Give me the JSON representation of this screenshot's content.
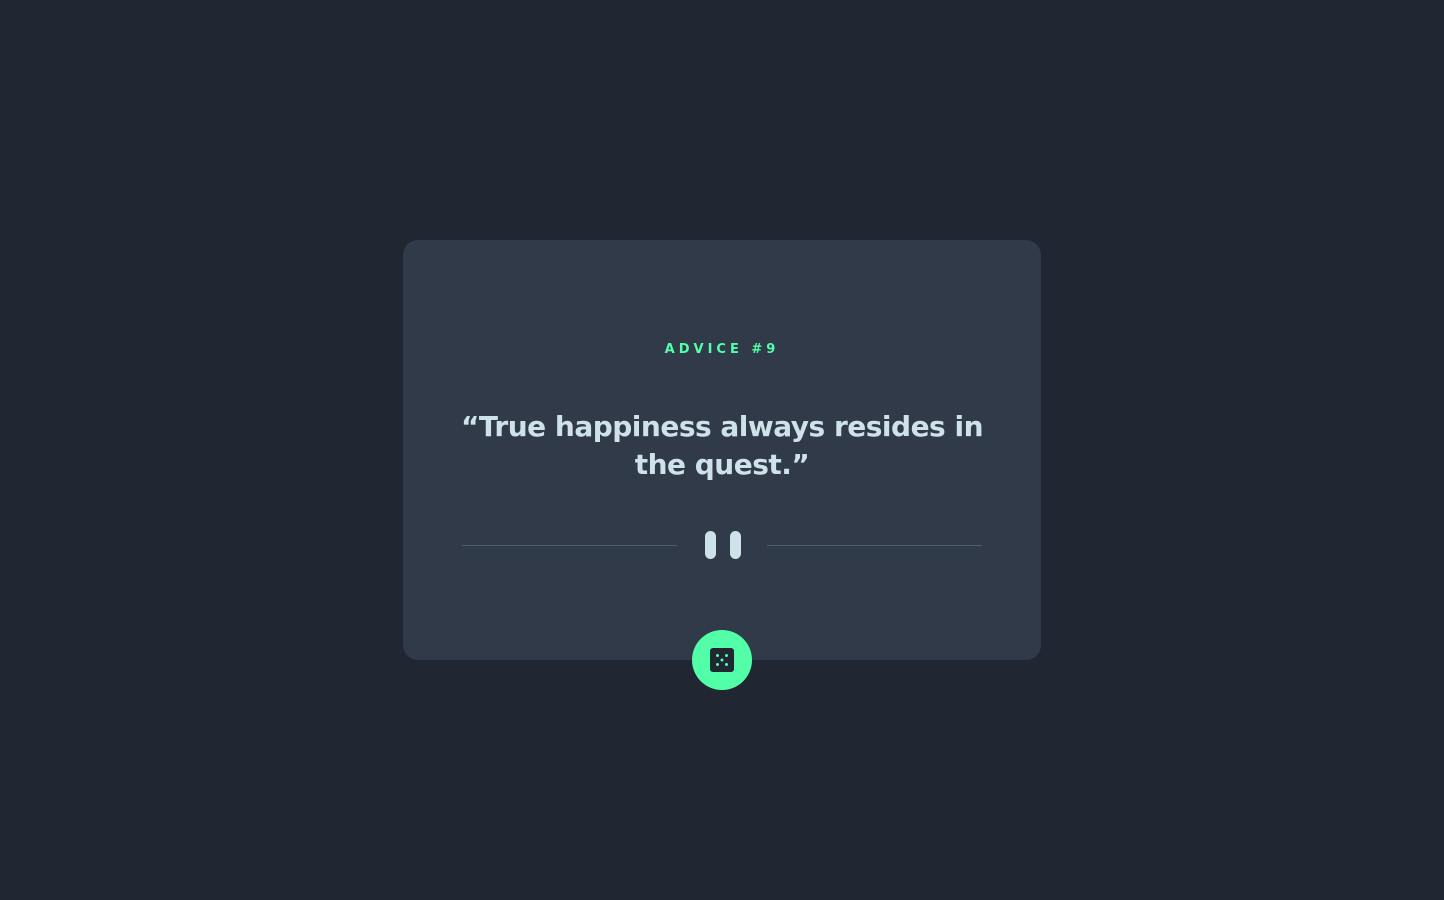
{
  "advice": {
    "label": "ADVICE #9",
    "text": "“True happiness always resides in the quest.”"
  },
  "divider": {
    "icon": "pause-icon"
  },
  "dice_button": {
    "icon": "dice-icon"
  },
  "colors": {
    "background": "#202632",
    "card": "#313a49",
    "accent": "#52ffa8",
    "text": "#cee3e9",
    "divider_line": "#4f5d74"
  }
}
